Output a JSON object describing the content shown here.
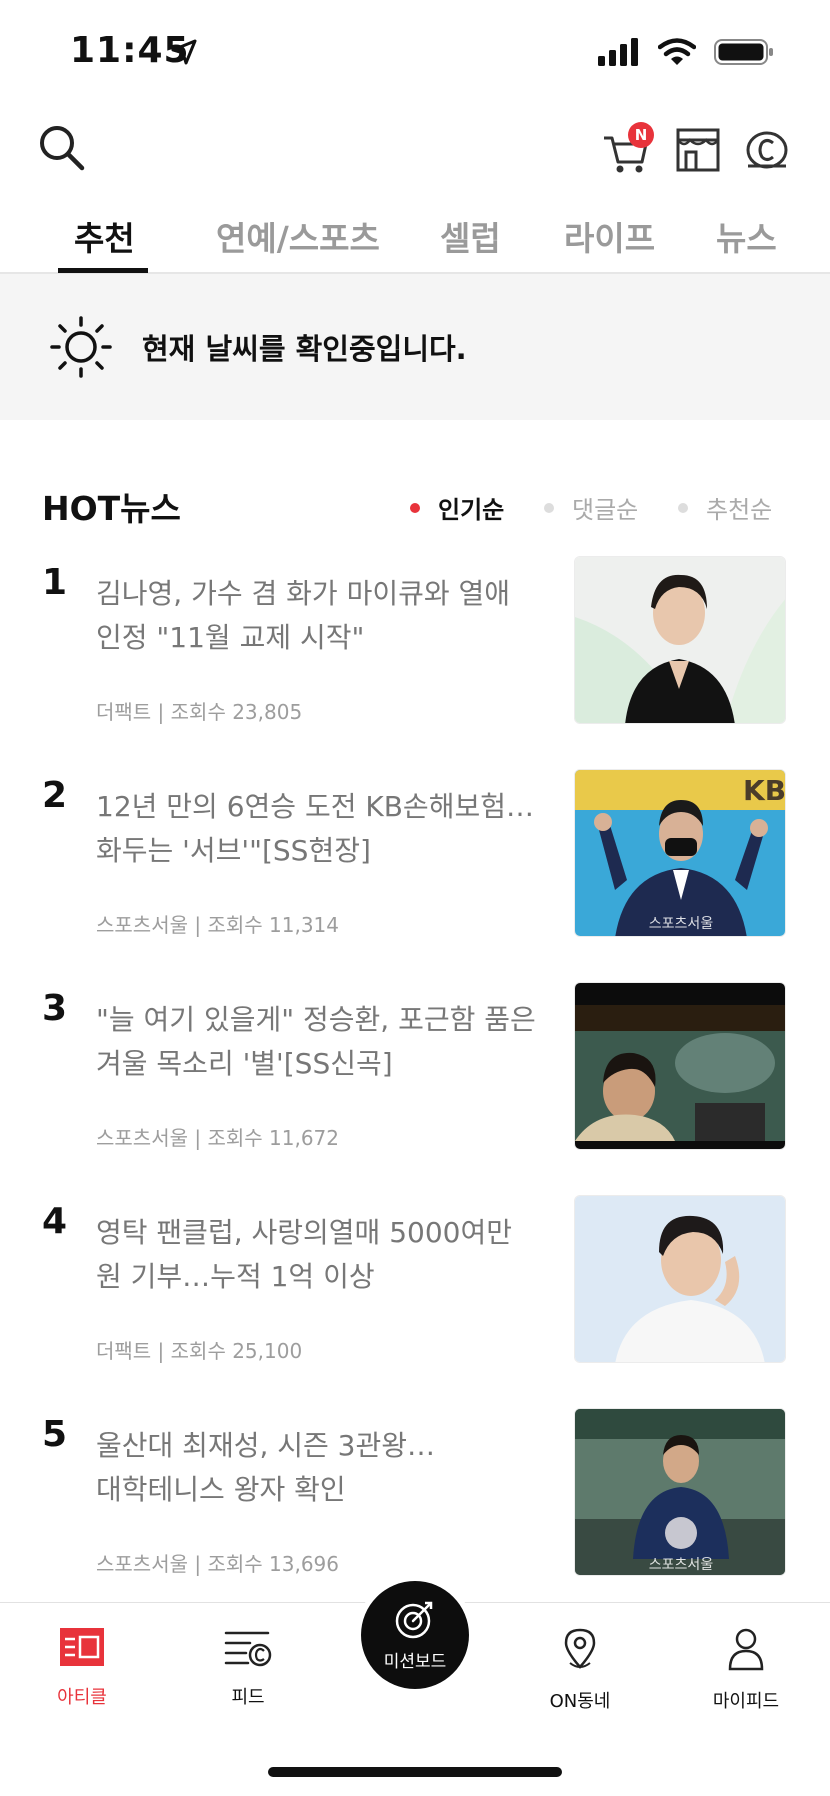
{
  "status": {
    "time": "11:45"
  },
  "toolbar": {
    "cart_badge": "N"
  },
  "tabs": [
    {
      "label": "추천",
      "active": true
    },
    {
      "label": "연예/스포츠",
      "active": false
    },
    {
      "label": "셀럽",
      "active": false
    },
    {
      "label": "라이프",
      "active": false
    },
    {
      "label": "뉴스",
      "active": false
    }
  ],
  "weather": {
    "text": "현재 날씨를 확인중입니다."
  },
  "hot": {
    "title": "HOT뉴스",
    "sorts": [
      {
        "label": "인기순",
        "active": true
      },
      {
        "label": "댓글순",
        "active": false
      },
      {
        "label": "추천순",
        "active": false
      }
    ],
    "items": [
      {
        "rank": "1",
        "line1": "김나영, 가수 겸 화가 마이큐와 열애",
        "line2": "인정 \"11월 교제 시작\"",
        "meta": "더팩트 | 조회수 23,805"
      },
      {
        "rank": "2",
        "line1": "12년 만의 6연승 도전 KB손해보험…",
        "line2": "화두는 '서브'\"[SS현장]",
        "meta": "스포츠서울 | 조회수 11,314"
      },
      {
        "rank": "3",
        "line1": "\"늘 여기 있을게\" 정승환, 포근함 품은",
        "line2": "겨울 목소리 '별'[SS신곡]",
        "meta": "스포츠서울 | 조회수 11,672"
      },
      {
        "rank": "4",
        "line1": "영탁 팬클럽, 사랑의열매 5000여만",
        "line2": "원 기부…누적 1억 이상",
        "meta": "더팩트 | 조회수 25,100"
      },
      {
        "rank": "5",
        "line1": "울산대 최재성, 시즌 3관왕…",
        "line2": "대학테니스 왕자 확인",
        "meta": "스포츠서울 | 조회수 13,696"
      }
    ]
  },
  "thumb_marks": {
    "kb": "KB",
    "watermark": "스포츠서울"
  },
  "nav": {
    "article": "아티클",
    "feed": "피드",
    "mission": "미션보드",
    "on": "ON동네",
    "my": "마이피드"
  },
  "colors": {
    "accent": "#e8333b",
    "text": "#111111",
    "muted": "#777777"
  }
}
